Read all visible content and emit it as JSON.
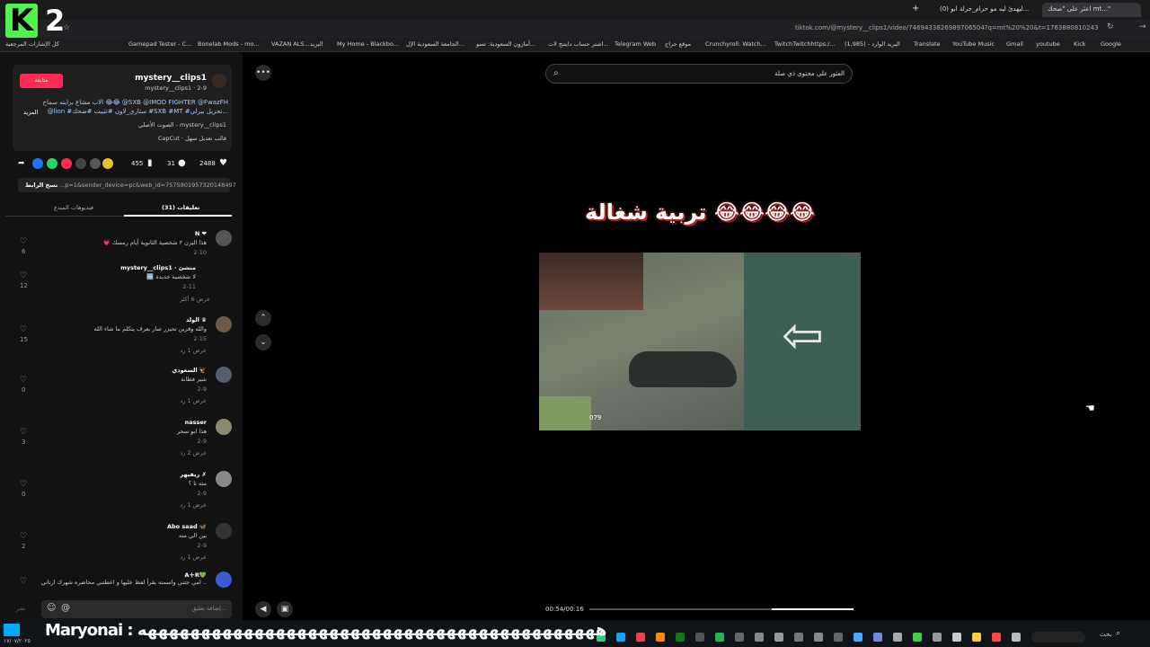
{
  "browser": {
    "tabs": [
      {
        "label": "اعثر على \"صحك mt...\"",
        "active": true
      },
      {
        "label": "(0) ليهدئ ليه مو حرام_جرلة ابو...",
        "active": false
      }
    ],
    "url": "tiktok.com/@mystery__clips1/video/7469433826989706504?q=mt%20%20&t=1763880810243",
    "bookmarks": [
      "كل الإشارات المرجعية",
      "Gamepad Tester - C...",
      "Bonelab Mods - mo...",
      "VAZAN ALS...",
      "البريد",
      "My Home - Blackbo...",
      "الجامعة السعودية الإل...",
      "أمازون السعودية: تسو...",
      "اشتر حساب دايتنج لات...",
      "Telegram Web",
      "موقع حراج",
      "Crunchyroll: Watch...",
      "TwitchTwitchhttps:/...",
      "(1,985) - البريد الوارد",
      "Translate",
      "YouTube Music",
      "Gmail",
      "youtube",
      "Kick",
      "Google"
    ]
  },
  "overlay": {
    "logo_letter": "K",
    "logo_number": "2",
    "marquee": "Maryonai : هههههههههههههههههههههههههههههههههههههههههههه"
  },
  "post": {
    "username": "mystery__clips1",
    "meta": "mystery__clips1 · 2-9",
    "follow_label": "متابعة",
    "description": "الاب مشاع برايته سماح 😂😂 @SXB @IMOD FIGHTER @FwazFH",
    "description2": "@lion #ستاري_لاون #تثبيت #ضحك #SXB #MT #تحزيل بيرلي...",
    "more_label": "المزيد",
    "sound": "الصوت الأصلي - mystery__clips1",
    "capcut": "CapCut · قالب تعديل سهل",
    "likes": "2488",
    "comments": "31",
    "saves": "455",
    "link_text": "...p=1&sender_device=pc&web_id=7575801957320148497",
    "copy_link": "نسخ الرابط",
    "tab_comments": "تعليقات (31)",
    "tab_creator_videos": "فيديوهات المبدع"
  },
  "comments": [
    {
      "user": "N ❤",
      "text": "💗 هذا اليرن ٢ شخصية الثانوية أيام رمسك",
      "date": "2-10",
      "likes": "6"
    },
    {
      "user": "mystery__clips1 · منشئ",
      "text": "🆒 لا شخصية جديدة",
      "date": "2-11",
      "likes": "12",
      "more": "عرض 6 أكثر"
    },
    {
      "user": "الولد ♛",
      "text": "والله وقرين تحيزر صار بعرف يتكلم ما شاء الله",
      "date": "2-15",
      "likes": "15",
      "more": "عرض 1 رد"
    },
    {
      "user": "السعودي 🦅",
      "text": "شير فطانة",
      "date": "2-9",
      "likes": "0",
      "more": "عرض 1 رد"
    },
    {
      "user": "nasser",
      "text": "هذا ابو سحر",
      "date": "2-9",
      "likes": "3",
      "more": "عرض 2 رد"
    },
    {
      "user": "ريفيهر ✗",
      "text": "مته تا ؟",
      "date": "2-9",
      "likes": "0",
      "more": "عرض 1 رد"
    },
    {
      "user": "Abo saad 🦋",
      "text": "بين الي منه",
      "date": "2-9",
      "likes": "2",
      "more": "عرض 1 رد"
    },
    {
      "user": "A＋R💚",
      "text": "امي جتني واسمته يقرأ لفظ عليها و اعطتني محاضره شهرك ارتاني ..",
      "date": "",
      "likes": ""
    }
  ],
  "comment_input_placeholder": "إضافة تعليق...",
  "comment_post_label": "نشر",
  "reply_label": "رد",
  "video": {
    "search_placeholder": "العثور على محتوى ذي صلة",
    "caption": "تربية شغالة 😂😂😂😂",
    "time": "00:54/00:16",
    "progress": 0.69,
    "hud_number": "079"
  },
  "taskbar": {
    "search_label": "بحث",
    "time": "١٧/٠٧/٢٠٢٥"
  },
  "colors": {
    "accent": "#fe2c55",
    "kick_green": "#52f050"
  }
}
